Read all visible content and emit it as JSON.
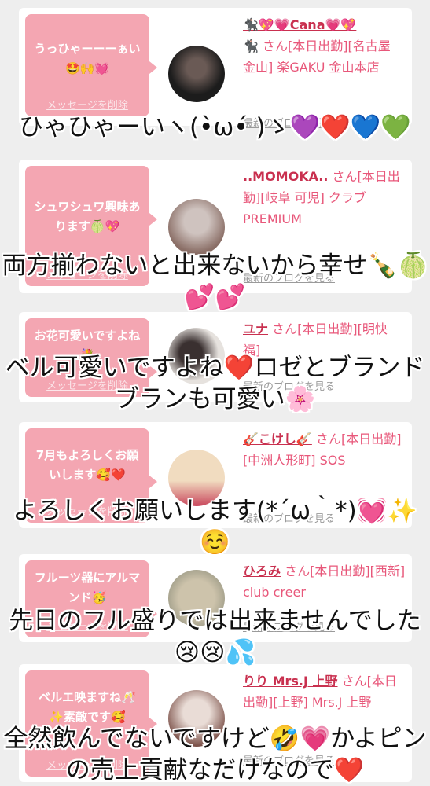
{
  "messages": [
    {
      "bubble": "うっひゃーーーぁい🤩🙌💓",
      "delete_label": "メッセージを削除",
      "name": "🐈‍⬛💖💗Cana💗💖",
      "detail": "🐈‍⬛ さん[本日出勤][名古屋 金山] 楽GAKU 金山本店",
      "blog_link": "最新のブログを見る",
      "caption": "ひゃひゃーいヽ(•̀ω•́ )ゝ💜❤️💙💚",
      "avatar_colors": [
        "#1c1c1c",
        "#6a5a55"
      ]
    },
    {
      "bubble": "シュワシュワ興味あります🍈💖",
      "delete_label": "メッセージを削除",
      "name": "..MOMOKA..",
      "detail": " さん[本日出勤][岐阜 可児] クラブ PREMIUM",
      "blog_link": "最新のブログを見る",
      "caption": "両方揃わないと出来ないから幸せ🍾🍈💕💕",
      "avatar_colors": [
        "#cfc3bf",
        "#8a6e66"
      ]
    },
    {
      "bubble": "お花可愛いですよね💐",
      "delete_label": "メッセージを削除",
      "name": "ユナ",
      "detail": " さん[本日出勤][明快 福]",
      "blog_link": "最新のブログを見る",
      "caption": "ベル可愛いですよね❤️ロゼとブランドブランも可愛い🌸",
      "avatar_colors": [
        "#e6e2de",
        "#3a3030"
      ]
    },
    {
      "bubble": "7月もよろしくお願いします🥰❤️",
      "delete_label": "メッセージを削除",
      "name": "🎸こけし🎸",
      "detail": " さん[本日出勤][中洲人形町] SOS",
      "blog_link": "最新のブログを見る",
      "caption": "よろしくお願いします(*´ω｀*)💓✨☺️",
      "avatar_colors": [
        "#f1dcc0",
        "#c9475c"
      ]
    },
    {
      "bubble": "フルーツ器にアルマンド🥳",
      "delete_label": "メッセージを削除",
      "name": "ひろみ",
      "detail": " さん[本日出勤][西新] club creer",
      "blog_link": "最新のブログを見る",
      "caption": "先日のフル盛りでは出来ませんでした😢😢💦",
      "avatar_colors": [
        "#cdc3ab",
        "#9c9a86"
      ]
    },
    {
      "bubble": "ベルエ映ますね🥂✨素敵です🥰",
      "delete_label": "メッセージを削除",
      "name": "りり Mrs.J 上野",
      "detail": " さん[本日出勤][上野] Mrs.J 上野",
      "blog_link": "最新のブログを見る",
      "caption": "全然飲んでないですけど🤣💗かよピンの売上貢献なだけなので❤️",
      "avatar_colors": [
        "#e9dcd6",
        "#7a4f47"
      ]
    }
  ]
}
